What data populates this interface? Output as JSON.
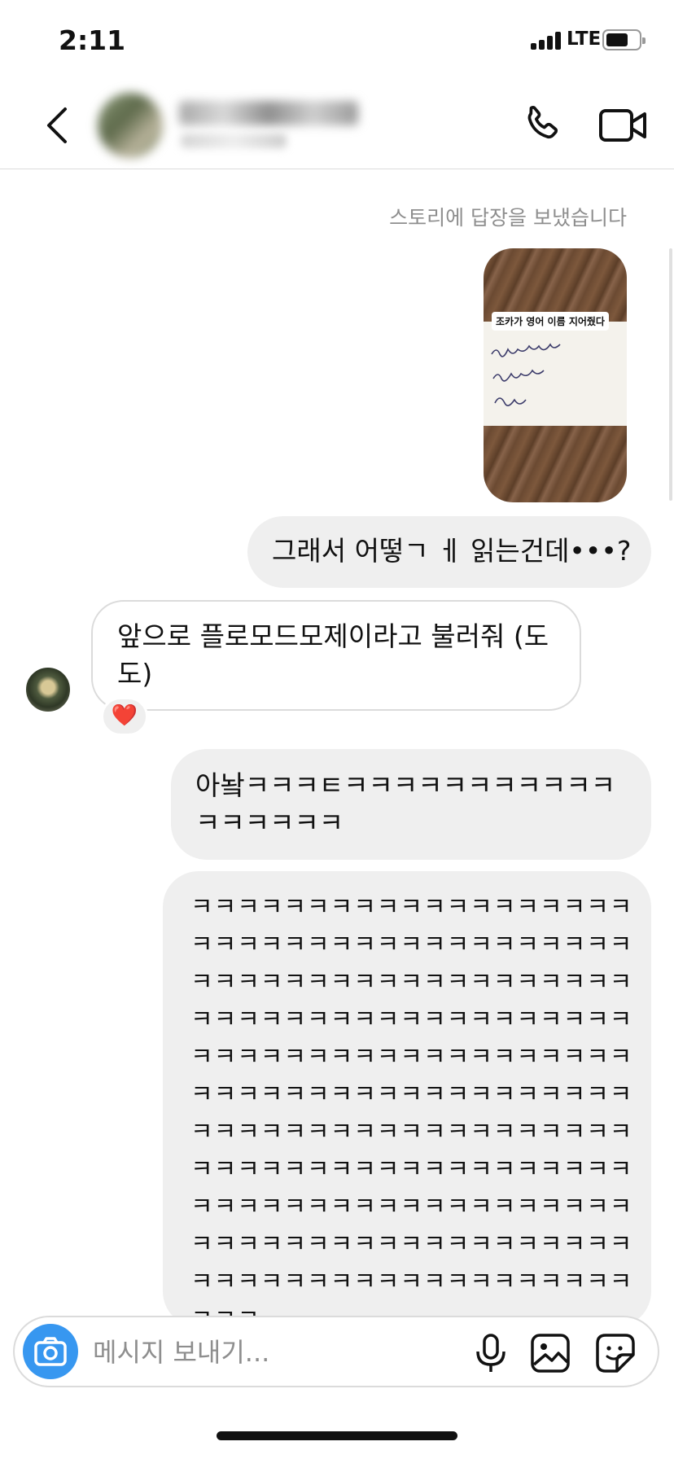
{
  "status_bar": {
    "time": "2:11",
    "network": "LTE"
  },
  "header": {
    "contact_name": "",
    "contact_subtitle": ""
  },
  "chat": {
    "story_reply_caption": "스토리에 답장을 보냈습니다",
    "story_label": "조카가 영어 이름 지어줬다",
    "messages": [
      {
        "direction": "out",
        "text": "그래서 어떻ㄱ ㅔ 읽는건데•••?"
      },
      {
        "direction": "in",
        "text": "앞으로 플로모드모제이라고 불러줘 (도도)",
        "reaction": "❤️"
      },
      {
        "direction": "out",
        "text": "아놬ㅋㅋㅋㅌㅋㅋㅋㅋㅋㅋㅋㅋㅋㅋㅋㅋㅋㅋㅋㅋㅋ"
      },
      {
        "direction": "out",
        "lines": [
          "ㅋㅋㅋㅋㅋㅋㅋㅋㅋㅋㅋㅋㅋㅋㅋㅋㅋㅋㅋ",
          "ㅋㅋㅋㅋㅋㅋㅋㅋㅋㅋㅋㅋㅋㅋㅋㅋㅋㅋㅋ",
          "ㅋㅋㅋㅋㅋㅋㅋㅋㅋㅋㅋㅋㅋㅋㅋㅋㅋㅋㅋ",
          "ㅋㅋㅋㅋㅋㅋㅋㅋㅋㅋㅋㅋㅋㅋㅋㅋㅋㅋㅋ",
          "ㅋㅋㅋㅋㅋㅋㅋㅋㅋㅋㅋㅋㅋㅋㅋㅋㅋㅋㅋ",
          "ㅋㅋㅋㅋㅋㅋㅋㅋㅋㅋㅋㅋㅋㅋㅋㅋㅋㅋㅋ",
          "ㅋㅋㅋㅋㅋㅋㅋㅋㅋㅋㅋㅋㅋㅋㅋㅋㅋㅋㅋ",
          "ㅋㅋㅋㅋㅋㅋㅋㅋㅋㅋㅋㅋㅋㅋㅋㅋㅋㅋㅋ",
          "ㅋㅋㅋㅋㅋㅋㅋㅋㅋㅋㅋㅋㅋㅋㅋㅋㅋㅋㅋ",
          "ㅋㅋㅋㅋㅋㅋㅋㅋㅋㅋㅋㅋㅋㅋㅋㅋㅋㅋㅋ",
          "ㅋㅋㅋㅋㅋㅋㅋㅋㅋㅋㅋㅋㅋㅋㅋㅋㅋㅋㅋ",
          "ㅋㅋㅋ"
        ]
      }
    ]
  },
  "composer": {
    "placeholder": "메시지 보내기..."
  },
  "colors": {
    "accent_blue": "#3797f0",
    "outgoing_bubble": "#efefef",
    "incoming_border": "#dbdbdb",
    "reaction_heart": "#e0243b"
  },
  "icons": [
    "back-chevron-icon",
    "phone-icon",
    "video-camera-icon",
    "camera-icon",
    "microphone-icon",
    "gallery-icon",
    "sticker-icon",
    "heart-icon"
  ]
}
